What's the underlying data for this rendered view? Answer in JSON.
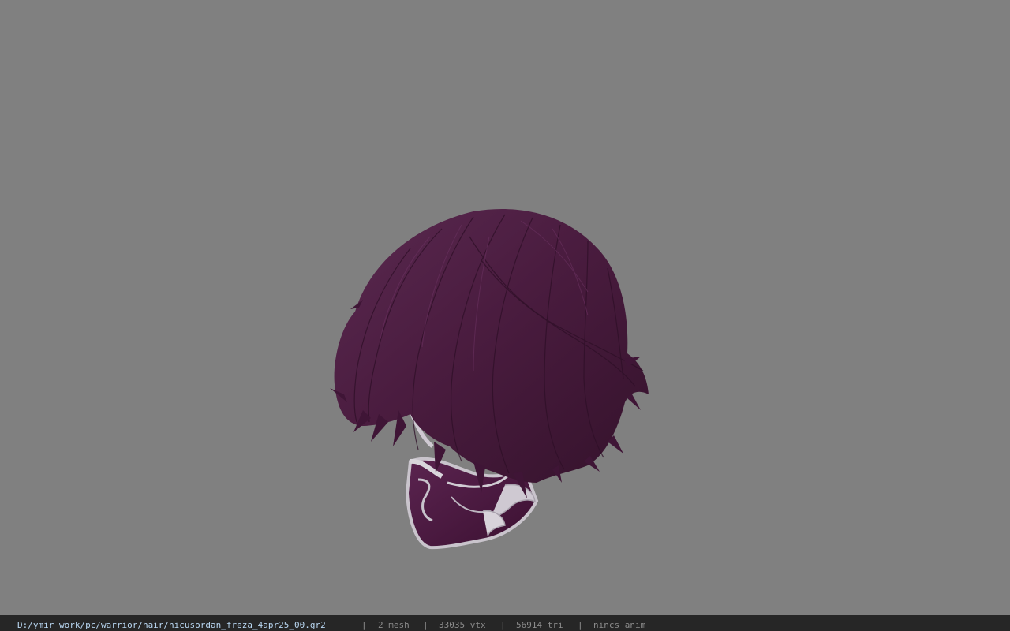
{
  "status": {
    "file_path": "D:/ymir work/pc/warrior/hair/nicusordan_freza_4apr25_00.gr2",
    "separator": "|",
    "mesh": "2 mesh",
    "vtx": "33035 vtx",
    "tri": "56914 tri",
    "anim": "nincs anim"
  },
  "colors": {
    "viewport_bg": "#808080",
    "statusbar_bg": "#262626",
    "path_text": "#b9d7f2",
    "stat_text": "#8c8c8c",
    "hair": "#4a1c3d",
    "mask_base": "#4d1a3f",
    "mask_trim": "#c8c3cc"
  },
  "model": {
    "icon": "hair-model-preview"
  }
}
